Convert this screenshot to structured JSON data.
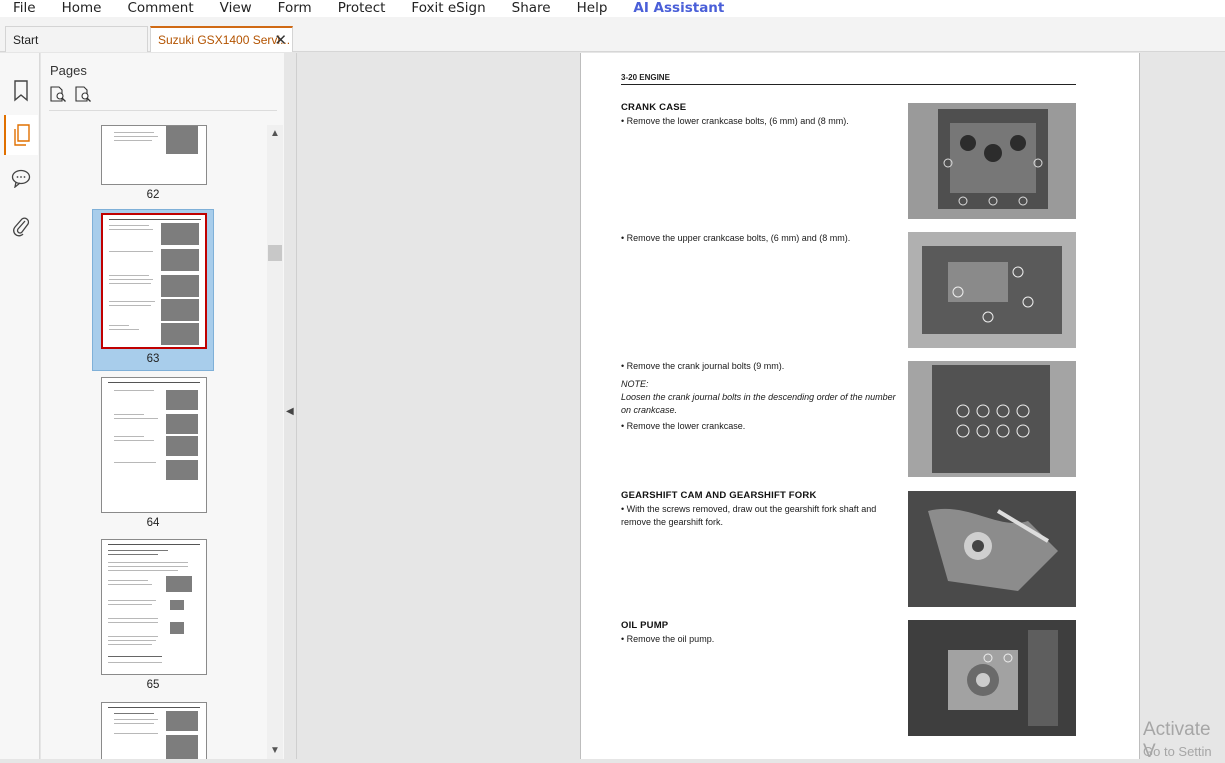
{
  "menu": {
    "items": [
      "File",
      "Home",
      "Comment",
      "View",
      "Form",
      "Protect",
      "Foxit eSign",
      "Share",
      "Help"
    ],
    "ai_assistant": "AI Assistant"
  },
  "tabs": {
    "start": "Start",
    "document": "Suzuki GSX1400 Servi...",
    "close_glyph": "✕"
  },
  "sidebar": {
    "title": "Pages",
    "icons": [
      "bookmark-icon",
      "pages-icon",
      "comments-icon",
      "attachment-icon"
    ]
  },
  "thumbnails": [
    {
      "page": "62"
    },
    {
      "page": "63",
      "selected": true
    },
    {
      "page": "64"
    },
    {
      "page": "65"
    }
  ],
  "page": {
    "header": "3-20    ENGINE",
    "sections": {
      "crank_case": "CRANK CASE",
      "gearshift": "GEARSHIFT CAM AND GEARSHIFT FORK",
      "oil_pump": "OIL PUMP"
    },
    "text": {
      "b1": "• Remove the lower crankcase bolts, (6 mm) and (8 mm).",
      "b2": "• Remove the upper crankcase bolts, (6 mm) and (8 mm).",
      "b3": "• Remove the crank journal bolts (9 mm).",
      "note_label": "NOTE:",
      "note_text": "Loosen the crank journal bolts in the descending order of the number on crankcase.",
      "b4": "• Remove the lower crankcase.",
      "b5": "• With the screws removed, draw out the gearshift fork shaft and remove the gearshift fork.",
      "b6": "• Remove the oil pump."
    }
  },
  "watermark": {
    "line1": "Activate V",
    "line2": "Go to Settin"
  },
  "colors": {
    "accent_tab": "#d06a14",
    "ai_blue": "#4a5fd8",
    "thumb_selected": "#a8cdeb",
    "thumb_highlight_border": "#c00000"
  }
}
